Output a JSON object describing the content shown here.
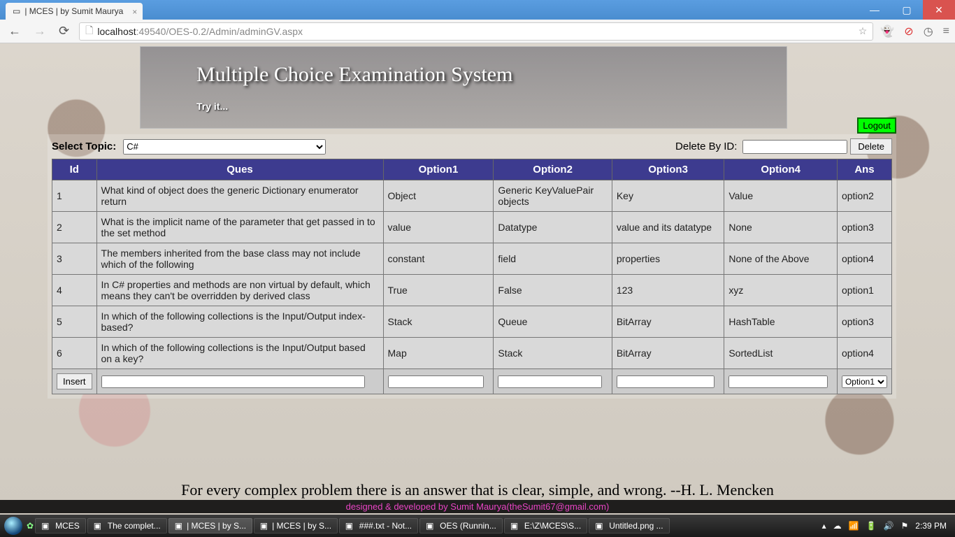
{
  "browser": {
    "tab_title": "| MCES | by Sumit Maurya",
    "url_host": "localhost",
    "url_rest": ":49540/OES-0.2/Admin/adminGV.aspx"
  },
  "header": {
    "title": "Multiple Choice Examination System",
    "subtitle": "Try  it..."
  },
  "controls": {
    "select_topic_label": "Select Topic:",
    "topic_selected": "C#",
    "delete_label": "Delete By ID:",
    "delete_button": "Delete",
    "delete_value": "",
    "logout": "Logout",
    "insert": "Insert",
    "new_ans_selected": "Option1"
  },
  "table": {
    "headers": [
      "Id",
      "Ques",
      "Option1",
      "Option2",
      "Option3",
      "Option4",
      "Ans"
    ],
    "rows": [
      {
        "id": "1",
        "ques": "What kind of object does the generic Dictionary enumerator return",
        "o1": "Object",
        "o2": "Generic KeyValuePair objects",
        "o3": "Key",
        "o4": "Value",
        "ans": "option2"
      },
      {
        "id": "2",
        "ques": "What is the implicit name of the parameter that get passed in to the set method",
        "o1": "value",
        "o2": "Datatype",
        "o3": "value and its datatype",
        "o4": "None",
        "ans": "option3"
      },
      {
        "id": "3",
        "ques": "The members inherited from the base class may not include which of the following",
        "o1": "constant",
        "o2": "field",
        "o3": "properties",
        "o4": "None of the Above",
        "ans": "option4"
      },
      {
        "id": "4",
        "ques": "In C# properties and methods are non virtual by default, which means they can't be overridden by derived class",
        "o1": "True",
        "o2": "False",
        "o3": "123",
        "o4": "xyz",
        "ans": "option1"
      },
      {
        "id": "5",
        "ques": "In which of the following collections is the Input/Output index-based?",
        "o1": "Stack",
        "o2": "Queue",
        "o3": "BitArray",
        "o4": "HashTable",
        "ans": "option3"
      },
      {
        "id": "6",
        "ques": "In which of the following collections is the Input/Output based on a key?",
        "o1": "Map",
        "o2": "Stack",
        "o3": "BitArray",
        "o4": "SortedList",
        "ans": "option4"
      }
    ]
  },
  "quote": "For every complex problem there is an answer that is clear, simple, and wrong. --H. L. Mencken",
  "credit": "designed & developed by Sumit Maurya(theSumit67@gmail.com)",
  "taskbar": {
    "items": [
      "MCES",
      "The complet...",
      "| MCES | by S...",
      "| MCES | by S...",
      "###.txt - Not...",
      "OES (Runnin...",
      "E:\\Z\\MCES\\S...",
      "Untitled.png ..."
    ],
    "time": "2:39 PM"
  }
}
